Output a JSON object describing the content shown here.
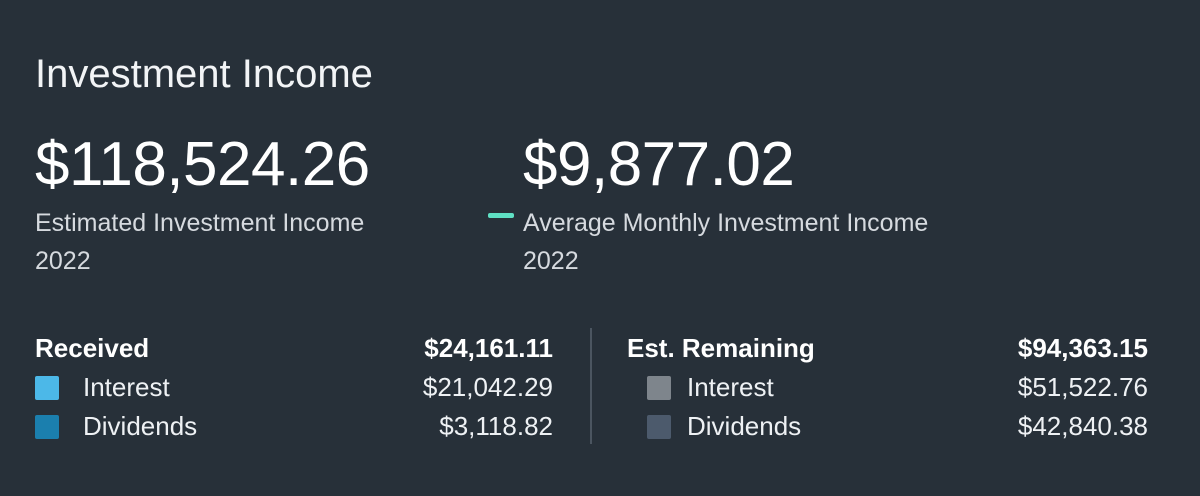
{
  "card": {
    "title": "Investment Income"
  },
  "metrics": {
    "estimated": {
      "value": "$118,524.26",
      "label_line1": "Estimated Investment Income",
      "label_line2": "2022"
    },
    "average_monthly": {
      "value": "$9,877.02",
      "label_line1": "Average Monthly Investment Income",
      "label_line2": "2022",
      "legend_color": "#5fe0c4"
    }
  },
  "received": {
    "label": "Received",
    "total": "$24,161.11",
    "items": [
      {
        "label": "Interest",
        "amount": "$21,042.29",
        "color": "#4cb8e8"
      },
      {
        "label": "Dividends",
        "amount": "$3,118.82",
        "color": "#1b7fae"
      }
    ]
  },
  "remaining": {
    "label": "Est. Remaining",
    "total": "$94,363.15",
    "items": [
      {
        "label": "Interest",
        "amount": "$51,522.76",
        "color": "#7e858c"
      },
      {
        "label": "Dividends",
        "amount": "$42,840.38",
        "color": "#4c5a6c"
      }
    ]
  }
}
